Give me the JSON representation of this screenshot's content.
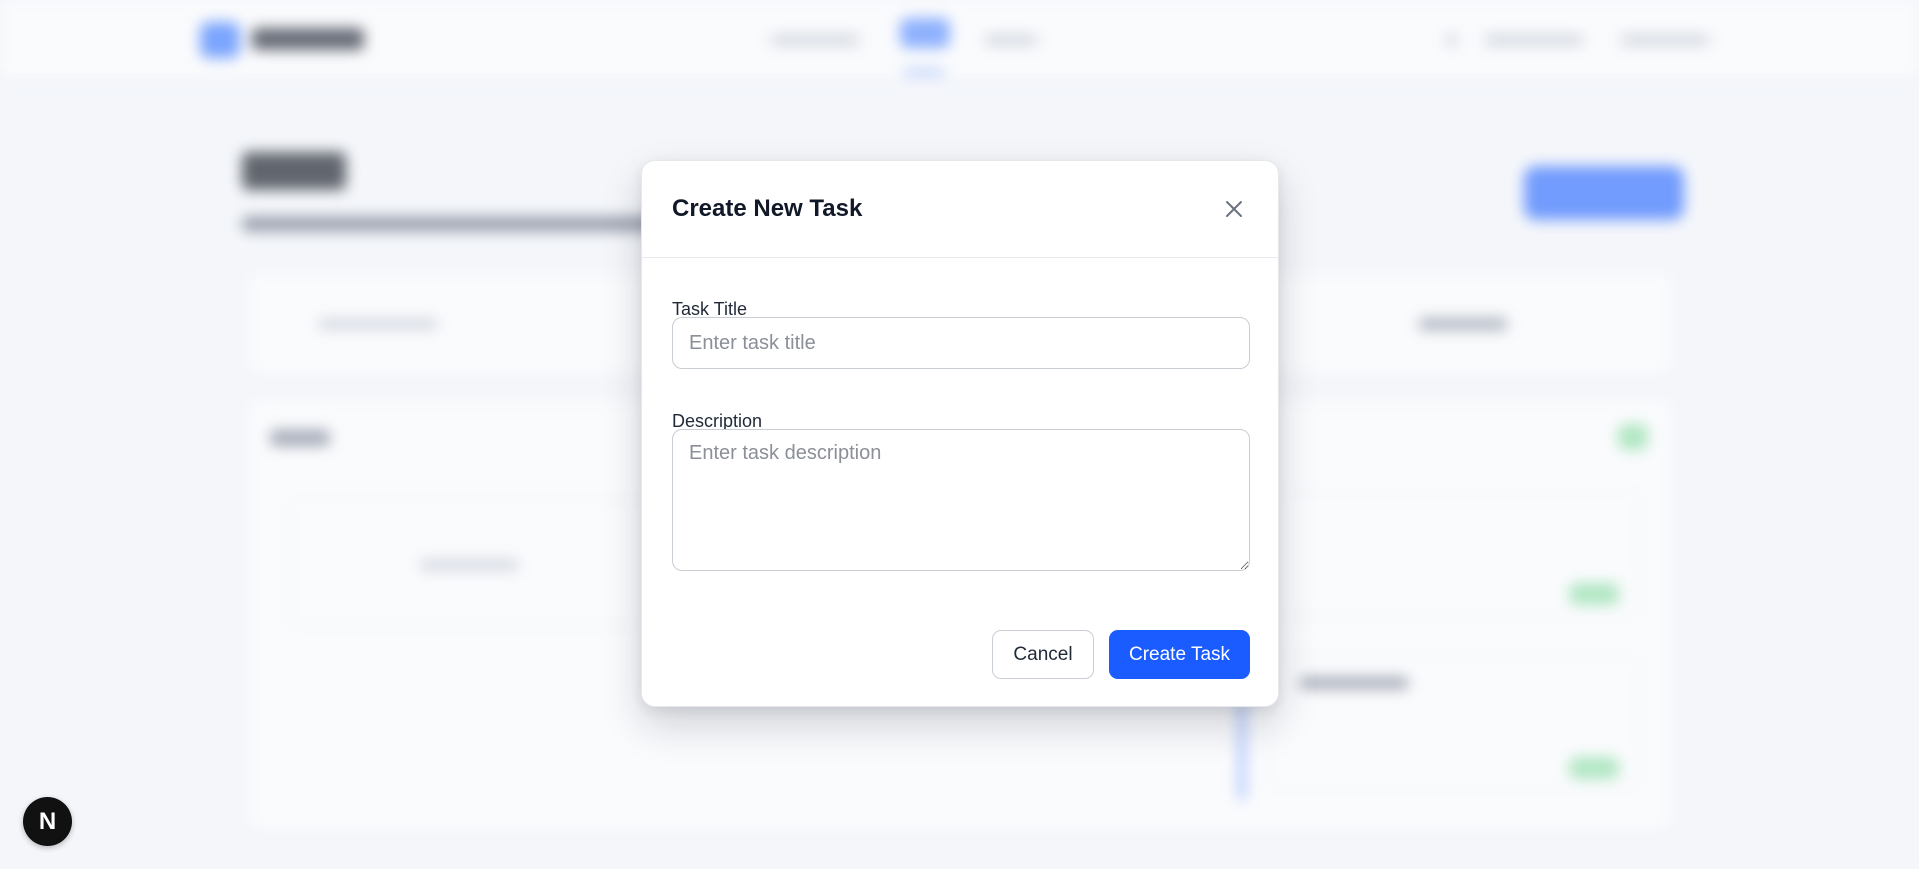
{
  "modal": {
    "title": "Create New Task",
    "close_icon": "close-icon",
    "fields": {
      "title": {
        "label": "Task Title",
        "value": "",
        "placeholder": "Enter task title"
      },
      "description": {
        "label": "Description",
        "value": "",
        "placeholder": "Enter task description"
      }
    },
    "buttons": {
      "cancel": "Cancel",
      "create": "Create Task"
    }
  },
  "floating_badge": {
    "letter": "N",
    "icon": "next-logo-icon"
  },
  "colors": {
    "primary": "#1a5cff",
    "title_text": "#111827",
    "border": "#c9cdd4",
    "placeholder": "#8a8f98"
  }
}
